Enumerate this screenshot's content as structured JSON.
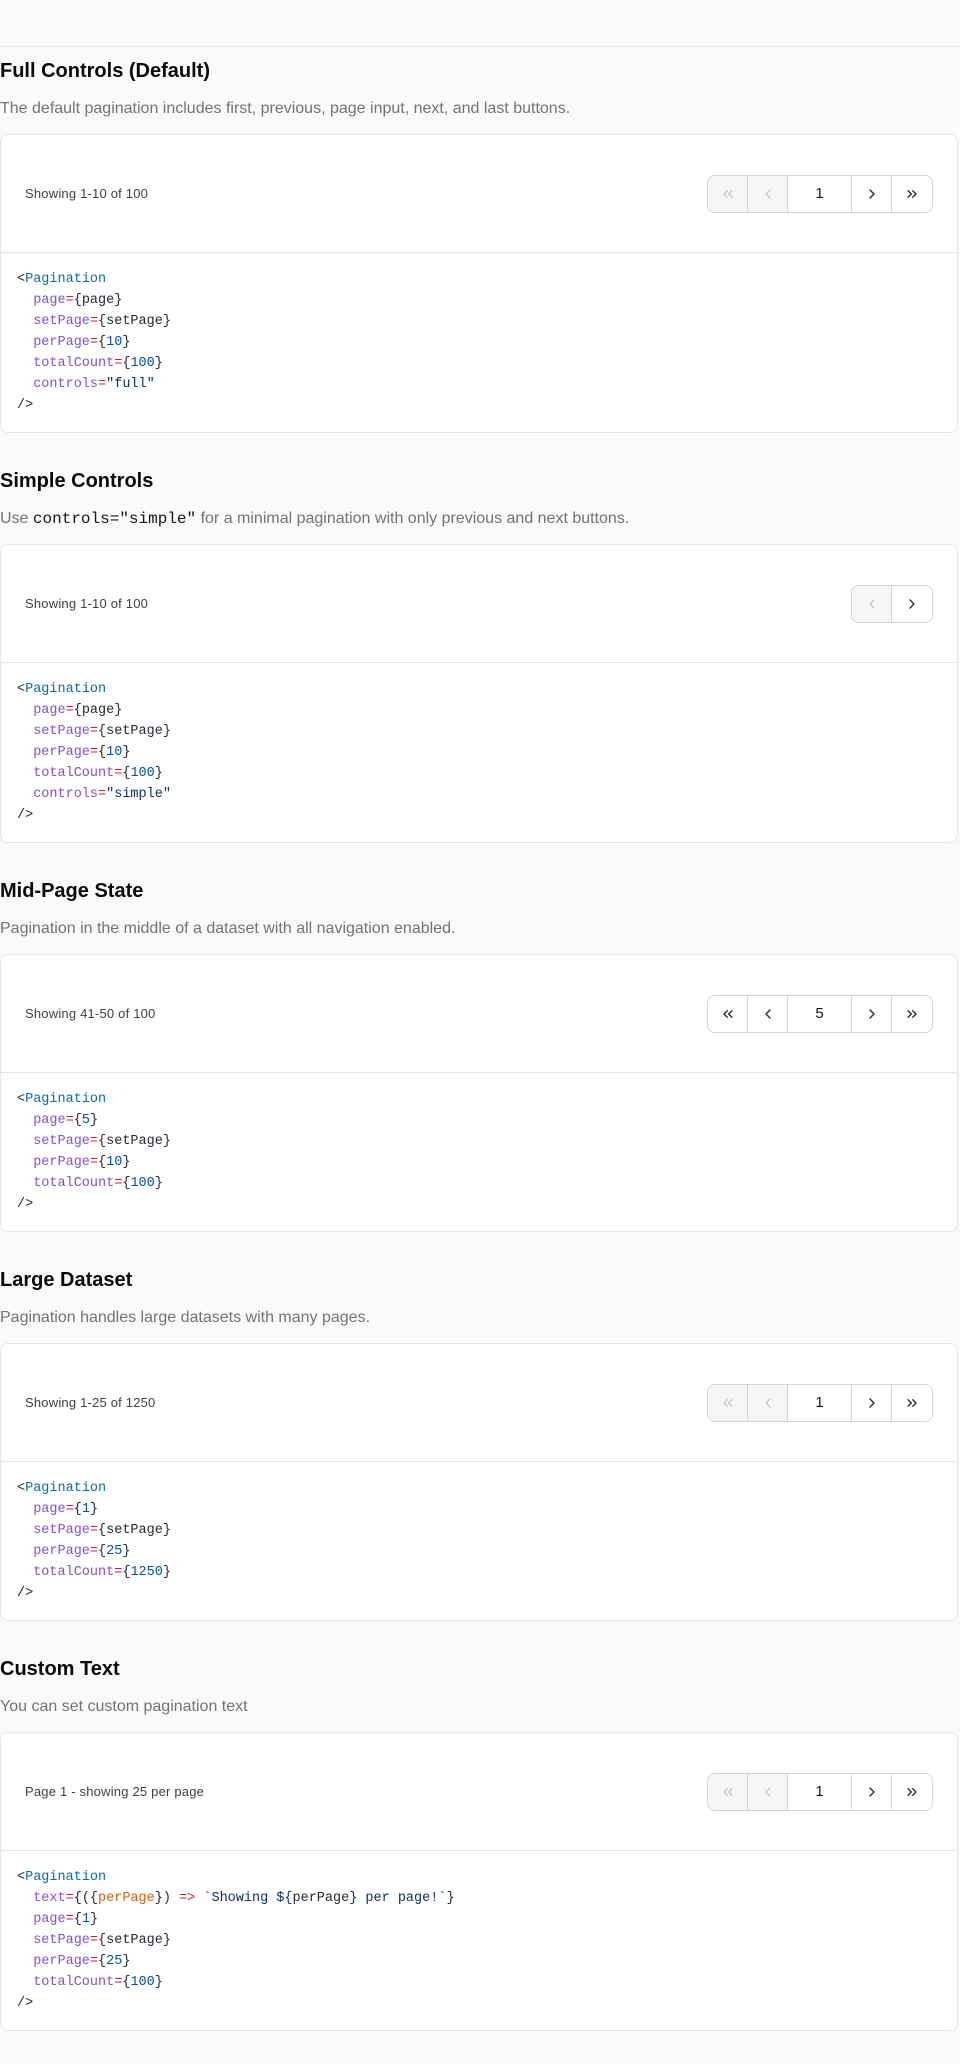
{
  "sections": [
    {
      "title": "Full Controls (Default)",
      "description": "The default pagination includes first, previous, page input, next, and last buttons.",
      "showing": "Showing 1-10 of 100",
      "page_value": "1",
      "controls": "full",
      "first_disabled": true,
      "prev_disabled": true,
      "code": [
        [
          [
            "plain",
            "<"
          ],
          [
            "tag",
            "Pagination"
          ]
        ],
        [
          [
            "attr",
            "  page"
          ],
          [
            "eq",
            "="
          ],
          [
            "plain",
            "{page}"
          ]
        ],
        [
          [
            "attr",
            "  setPage"
          ],
          [
            "eq",
            "="
          ],
          [
            "plain",
            "{setPage}"
          ]
        ],
        [
          [
            "attr",
            "  perPage"
          ],
          [
            "eq",
            "="
          ],
          [
            "plain",
            "{"
          ],
          [
            "num",
            "10"
          ],
          [
            "plain",
            "}"
          ]
        ],
        [
          [
            "attr",
            "  totalCount"
          ],
          [
            "eq",
            "="
          ],
          [
            "plain",
            "{"
          ],
          [
            "num",
            "100"
          ],
          [
            "plain",
            "}"
          ]
        ],
        [
          [
            "attr",
            "  controls"
          ],
          [
            "eq",
            "="
          ],
          [
            "str",
            "\"full\""
          ]
        ],
        [
          [
            "plain",
            "/>"
          ]
        ]
      ]
    },
    {
      "title": "Simple Controls",
      "description_prefix": "Use ",
      "description_code": "controls=\"simple\"",
      "description_suffix": " for a minimal pagination with only previous and next buttons.",
      "showing": "Showing 1-10 of 100",
      "controls": "simple",
      "prev_disabled": true,
      "code": [
        [
          [
            "plain",
            "<"
          ],
          [
            "tag",
            "Pagination"
          ]
        ],
        [
          [
            "attr",
            "  page"
          ],
          [
            "eq",
            "="
          ],
          [
            "plain",
            "{page}"
          ]
        ],
        [
          [
            "attr",
            "  setPage"
          ],
          [
            "eq",
            "="
          ],
          [
            "plain",
            "{setPage}"
          ]
        ],
        [
          [
            "attr",
            "  perPage"
          ],
          [
            "eq",
            "="
          ],
          [
            "plain",
            "{"
          ],
          [
            "num",
            "10"
          ],
          [
            "plain",
            "}"
          ]
        ],
        [
          [
            "attr",
            "  totalCount"
          ],
          [
            "eq",
            "="
          ],
          [
            "plain",
            "{"
          ],
          [
            "num",
            "100"
          ],
          [
            "plain",
            "}"
          ]
        ],
        [
          [
            "attr",
            "  controls"
          ],
          [
            "eq",
            "="
          ],
          [
            "str",
            "\"simple\""
          ]
        ],
        [
          [
            "plain",
            "/>"
          ]
        ]
      ]
    },
    {
      "title": "Mid-Page State",
      "description": "Pagination in the middle of a dataset with all navigation enabled.",
      "showing": "Showing 41-50 of 100",
      "page_value": "5",
      "controls": "full",
      "first_disabled": false,
      "prev_disabled": false,
      "code": [
        [
          [
            "plain",
            "<"
          ],
          [
            "tag",
            "Pagination"
          ]
        ],
        [
          [
            "attr",
            "  page"
          ],
          [
            "eq",
            "="
          ],
          [
            "plain",
            "{"
          ],
          [
            "num",
            "5"
          ],
          [
            "plain",
            "}"
          ]
        ],
        [
          [
            "attr",
            "  setPage"
          ],
          [
            "eq",
            "="
          ],
          [
            "plain",
            "{setPage}"
          ]
        ],
        [
          [
            "attr",
            "  perPage"
          ],
          [
            "eq",
            "="
          ],
          [
            "plain",
            "{"
          ],
          [
            "num",
            "10"
          ],
          [
            "plain",
            "}"
          ]
        ],
        [
          [
            "attr",
            "  totalCount"
          ],
          [
            "eq",
            "="
          ],
          [
            "plain",
            "{"
          ],
          [
            "num",
            "100"
          ],
          [
            "plain",
            "}"
          ]
        ],
        [
          [
            "plain",
            "/>"
          ]
        ]
      ]
    },
    {
      "title": "Large Dataset",
      "description": "Pagination handles large datasets with many pages.",
      "showing": "Showing 1-25 of 1250",
      "page_value": "1",
      "controls": "full",
      "first_disabled": true,
      "prev_disabled": true,
      "code": [
        [
          [
            "plain",
            "<"
          ],
          [
            "tag",
            "Pagination"
          ]
        ],
        [
          [
            "attr",
            "  page"
          ],
          [
            "eq",
            "="
          ],
          [
            "plain",
            "{"
          ],
          [
            "num",
            "1"
          ],
          [
            "plain",
            "}"
          ]
        ],
        [
          [
            "attr",
            "  setPage"
          ],
          [
            "eq",
            "="
          ],
          [
            "plain",
            "{setPage}"
          ]
        ],
        [
          [
            "attr",
            "  perPage"
          ],
          [
            "eq",
            "="
          ],
          [
            "plain",
            "{"
          ],
          [
            "num",
            "25"
          ],
          [
            "plain",
            "}"
          ]
        ],
        [
          [
            "attr",
            "  totalCount"
          ],
          [
            "eq",
            "="
          ],
          [
            "plain",
            "{"
          ],
          [
            "num",
            "1250"
          ],
          [
            "plain",
            "}"
          ]
        ],
        [
          [
            "plain",
            "/>"
          ]
        ]
      ]
    },
    {
      "title": "Custom Text",
      "description": "You can set custom pagination text",
      "showing": "Page 1 - showing 25 per page",
      "page_value": "1",
      "controls": "full",
      "first_disabled": true,
      "prev_disabled": true,
      "code": [
        [
          [
            "plain",
            "<"
          ],
          [
            "tag",
            "Pagination"
          ]
        ],
        [
          [
            "attr",
            "  text"
          ],
          [
            "eq",
            "="
          ],
          [
            "plain",
            "{({"
          ],
          [
            "param",
            "perPage"
          ],
          [
            "plain",
            "}) "
          ],
          [
            "eq",
            "=>"
          ],
          [
            "plain",
            " "
          ],
          [
            "str",
            "`Showing ${"
          ],
          [
            "plain",
            "perPage"
          ],
          [
            "str",
            "} per page!`"
          ],
          [
            "plain",
            "}"
          ]
        ],
        [
          [
            "attr",
            "  page"
          ],
          [
            "eq",
            "="
          ],
          [
            "plain",
            "{"
          ],
          [
            "num",
            "1"
          ],
          [
            "plain",
            "}"
          ]
        ],
        [
          [
            "attr",
            "  setPage"
          ],
          [
            "eq",
            "="
          ],
          [
            "plain",
            "{setPage}"
          ]
        ],
        [
          [
            "attr",
            "  perPage"
          ],
          [
            "eq",
            "="
          ],
          [
            "plain",
            "{"
          ],
          [
            "num",
            "25"
          ],
          [
            "plain",
            "}"
          ]
        ],
        [
          [
            "attr",
            "  totalCount"
          ],
          [
            "eq",
            "="
          ],
          [
            "plain",
            "{"
          ],
          [
            "num",
            "100"
          ],
          [
            "plain",
            "}"
          ]
        ],
        [
          [
            "plain",
            "/>"
          ]
        ]
      ]
    }
  ]
}
